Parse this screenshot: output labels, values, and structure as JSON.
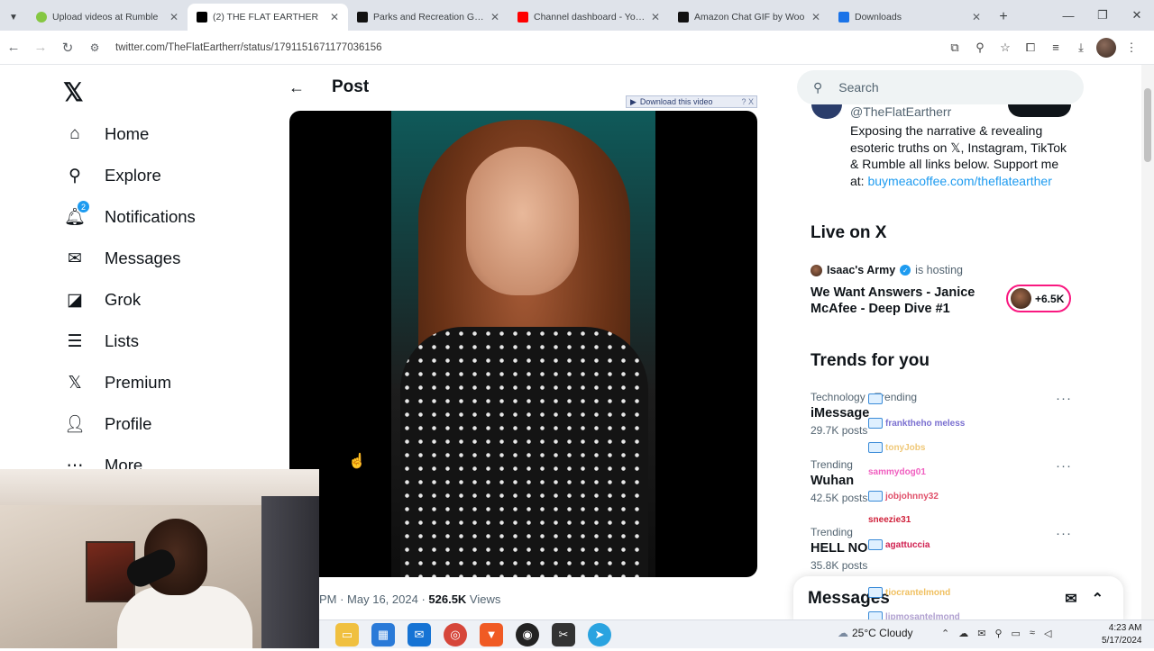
{
  "browser": {
    "tabs": [
      {
        "title": "Upload videos at Rumble",
        "favicon_color": "#85c742"
      },
      {
        "title": "(2) THE FLAT EARTHER",
        "favicon_color": "#000000",
        "active": true
      },
      {
        "title": "Parks and Recreation GIFs",
        "favicon_color": "#121212"
      },
      {
        "title": "Channel dashboard - YouT",
        "favicon_color": "#ff0000"
      },
      {
        "title": "Amazon Chat GIF by Woo",
        "favicon_color": "#121212"
      },
      {
        "title": "Downloads",
        "favicon_color": "#1a73e8"
      }
    ],
    "url": "twitter.com/TheFlatEartherr/status/1791151671177036156"
  },
  "nav": {
    "logo": "𝕏",
    "items": [
      {
        "label": "Home",
        "icon": "⌂"
      },
      {
        "label": "Explore",
        "icon": "⚲"
      },
      {
        "label": "Notifications",
        "icon": "🔔︎",
        "badge": "2"
      },
      {
        "label": "Messages",
        "icon": "✉"
      },
      {
        "label": "Grok",
        "icon": "◪"
      },
      {
        "label": "Lists",
        "icon": "☰"
      },
      {
        "label": "Premium",
        "icon": "𝕏"
      },
      {
        "label": "Profile",
        "icon": "👤︎"
      },
      {
        "label": "More",
        "icon": "⋯"
      }
    ]
  },
  "post": {
    "title": "Post",
    "download_label": "Download this video",
    "download_controls": "? X",
    "time": "PM · May 16, 2024 · ",
    "views_count": "526.5K",
    "views_label": " Views"
  },
  "sidebar": {
    "search_placeholder": "Search",
    "handle": "@TheFlatEartherr",
    "bio": "Exposing the narrative & revealing esoteric truths on 𝕏, Instagram, TikTok & Rumble all links below. Support me at: ",
    "bio_link": "buymeacoffee.com/theflatearther",
    "live_title": "Live on X",
    "host_name": "Isaac's Army",
    "host_suffix": "is hosting",
    "space_title": "We Want Answers - Janice McAfee - Deep Dive #1",
    "listeners": "+6.5K",
    "trends_title": "Trends for you",
    "trends": [
      {
        "category": "Technology · Trending",
        "name": "iMessage",
        "count": "29.7K posts"
      },
      {
        "category": "Trending",
        "name": "Wuhan",
        "count": "42.5K posts"
      },
      {
        "category": "Trending",
        "name": "HELL NO",
        "count": "35.8K posts"
      }
    ],
    "messages_label": "Messages"
  },
  "chat_overlay": [
    {
      "name": "",
      "color": "#9ab"
    },
    {
      "name": "franktheho meless",
      "color": "#7a6fd0"
    },
    {
      "name": "tonyJobs",
      "color": "#f0c878"
    },
    {
      "name": "sammydog01",
      "color": "#f05fc0"
    },
    {
      "name": "jobjohnny32",
      "color": "#e0506a"
    },
    {
      "name": "sneezie31",
      "color": "#d0203a"
    },
    {
      "name": "agattuccia",
      "color": "#d02050"
    },
    {
      "name": "",
      "color": "#aaa"
    },
    {
      "name": "tiocrantelmond",
      "color": "#f0c060"
    },
    {
      "name": "lipmosantelmond",
      "color": "#b0a0d0"
    }
  ],
  "taskbar": {
    "weather": "25°C  Cloudy",
    "time": "4:23 AM",
    "date": "5/17/2024"
  }
}
